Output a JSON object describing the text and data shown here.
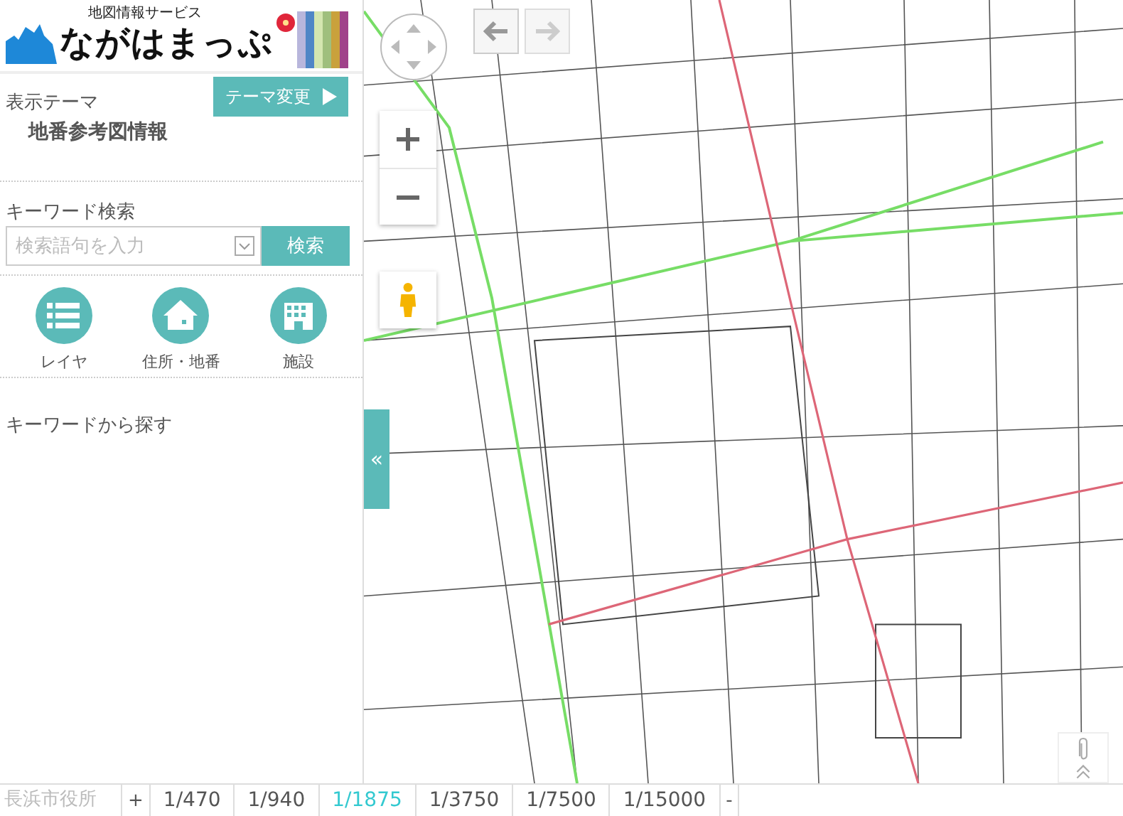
{
  "logo": {
    "subtitle": "地図情報サービス",
    "title": "ながはまっぷ"
  },
  "theme": {
    "label": "表示テーマ",
    "value": "地番参考図情報",
    "button": "テーマ変更"
  },
  "search": {
    "label": "キーワード検索",
    "placeholder": "検索語句を入力",
    "button": "検索"
  },
  "shortcuts": [
    {
      "kind": "layers",
      "label": "レイヤ"
    },
    {
      "kind": "address",
      "label": "住所・地番"
    },
    {
      "kind": "facility",
      "label": "施設"
    }
  ],
  "keyword_heading": "キーワードから探す",
  "map": {
    "kind": "picture",
    "collapse": "«"
  },
  "status_bar": {
    "location": "長浜市役所",
    "zoom_in": "+",
    "zoom_out": "-",
    "scales": [
      {
        "label": "1/470",
        "selected": false
      },
      {
        "label": "1/940",
        "selected": false
      },
      {
        "label": "1/1875",
        "selected": true
      },
      {
        "label": "1/3750",
        "selected": false
      },
      {
        "label": "1/7500",
        "selected": false
      },
      {
        "label": "1/15000",
        "selected": false
      }
    ]
  }
}
